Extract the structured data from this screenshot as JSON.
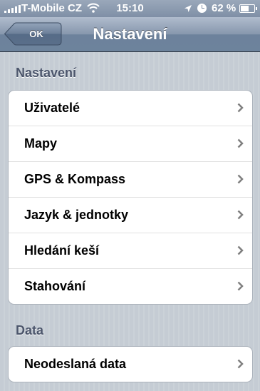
{
  "status_bar": {
    "carrier": "T-Mobile CZ",
    "time": "15:10",
    "battery": "62 %",
    "icons": [
      "signal-bars-icon",
      "wifi-icon",
      "location-arrow-icon",
      "clock-icon",
      "battery-icon"
    ]
  },
  "nav": {
    "back_label": "OK",
    "title": "Nastavení"
  },
  "sections": [
    {
      "header": "Nastavení",
      "items": [
        {
          "label": "Uživatelé"
        },
        {
          "label": "Mapy"
        },
        {
          "label": "GPS & Kompass"
        },
        {
          "label": "Jazyk & jednotky"
        },
        {
          "label": "Hledání keší"
        },
        {
          "label": "Stahování"
        }
      ]
    },
    {
      "header": "Data",
      "items": [
        {
          "label": "Neodeslaná data"
        }
      ]
    }
  ],
  "colors": {
    "nav_bar": "#6d839c",
    "background": "#c5ccd4",
    "section_header": "#4c566c",
    "chevron": "#7f7f7f"
  }
}
